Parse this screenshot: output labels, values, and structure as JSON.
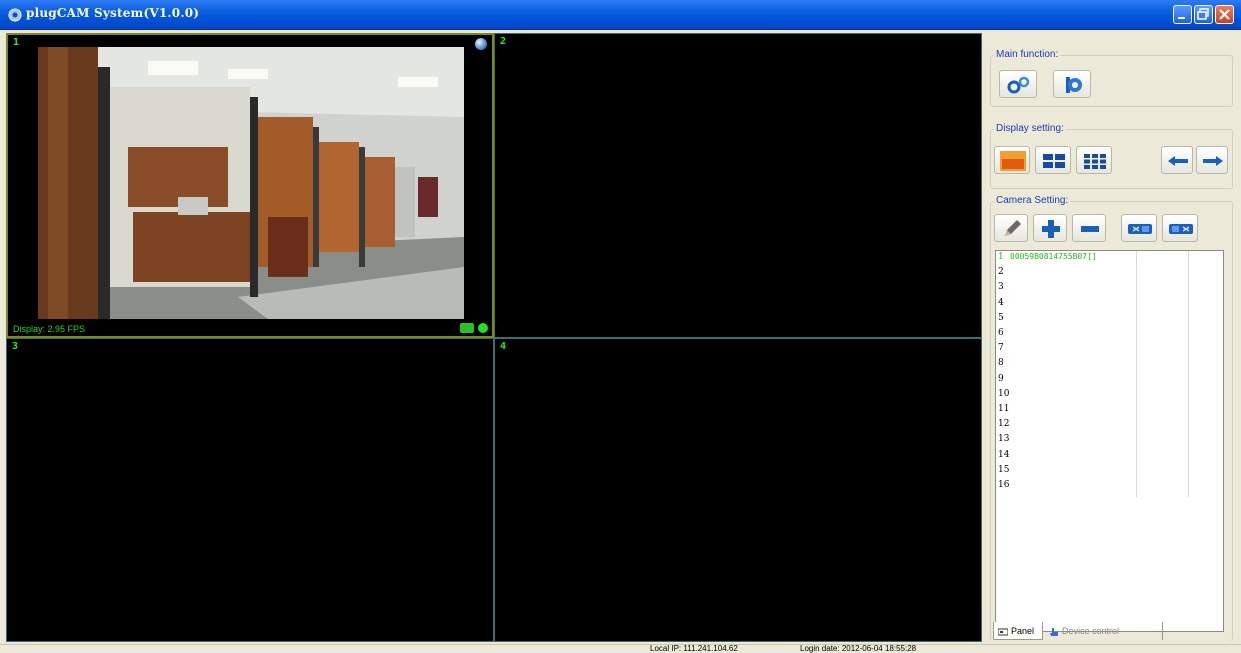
{
  "window": {
    "title": "plugCAM System(V1.0.0)",
    "icon": "camera-app-icon",
    "controls": [
      "minimize-icon",
      "maximize-icon",
      "close-icon"
    ]
  },
  "video": {
    "cells": [
      {
        "number": "1",
        "display_fps": "Display: 2.95 FPS",
        "feed": "office-interior",
        "active": true
      },
      {
        "number": "2"
      },
      {
        "number": "3"
      },
      {
        "number": "4"
      }
    ]
  },
  "panel": {
    "main_function": {
      "label": "Main function:",
      "buttons": [
        "settings-gears-icon",
        "playback-icon"
      ]
    },
    "display_setting": {
      "label": "Display setting:",
      "buttons": [
        "layout-1x1-icon",
        "layout-2x2-icon",
        "layout-3x3-icon",
        "arrow-left-icon",
        "arrow-right-icon"
      ]
    },
    "camera_setting": {
      "label": "Camera Setting:",
      "buttons": [
        "edit-pencil-icon",
        "add-plus-icon",
        "remove-minus-icon",
        "camera-connect-icon",
        "camera-disconnect-icon"
      ],
      "rows": [
        {
          "n": "1",
          "id": "00059B0814755B07[]"
        },
        {
          "n": "2",
          "id": ""
        },
        {
          "n": "3",
          "id": ""
        },
        {
          "n": "4",
          "id": ""
        },
        {
          "n": "5",
          "id": ""
        },
        {
          "n": "6",
          "id": ""
        },
        {
          "n": "7",
          "id": ""
        },
        {
          "n": "8",
          "id": ""
        },
        {
          "n": "9",
          "id": ""
        },
        {
          "n": "10",
          "id": ""
        },
        {
          "n": "11",
          "id": ""
        },
        {
          "n": "12",
          "id": ""
        },
        {
          "n": "13",
          "id": ""
        },
        {
          "n": "14",
          "id": ""
        },
        {
          "n": "15",
          "id": ""
        },
        {
          "n": "16",
          "id": ""
        }
      ]
    }
  },
  "tabs": [
    {
      "label": "Panel",
      "icon": "panel-icon",
      "active": true
    },
    {
      "label": "Device control",
      "icon": "hand-pointer-icon",
      "active": false
    }
  ],
  "status": {
    "local_ip": "Local IP: 111.241.104.62",
    "login": "Login date: 2012-06-04 18:55:28"
  },
  "colors": {
    "titlebar": "#0a5fe0",
    "video_bg": "#000000",
    "overlay_text": "#25f025",
    "active_cell_border": "#7a8a1c",
    "group_label": "#1a3fb0"
  }
}
